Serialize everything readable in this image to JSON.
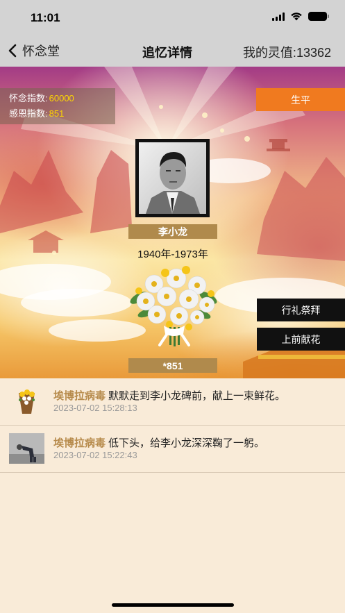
{
  "status_bar": {
    "time": "11:01",
    "icons": [
      "signal-icon",
      "wifi-icon",
      "battery-icon"
    ]
  },
  "nav": {
    "back_label": "怀念堂",
    "title": "追忆详情",
    "spirit_value": "我的灵值:13362"
  },
  "memorial": {
    "remembrance_label": "怀念指数:",
    "remembrance_value": "60000",
    "gratitude_label": "感恩指数:",
    "gratitude_value": "851",
    "biography_button": "生平",
    "name": "李小龙",
    "years": "1940年-1973年",
    "worship_button": "行礼祭拜",
    "offer_flower_button": "上前献花",
    "flower_count": "*851"
  },
  "feed": [
    {
      "user": "埃博拉病毒",
      "action": "默默走到李小龙碑前，献上一束鲜花。",
      "time": "2023-07-02 15:28:13",
      "avatar": "bouquet-avatar"
    },
    {
      "user": "埃博拉病毒",
      "action": "低下头，给李小龙深深鞠了一躬。",
      "time": "2023-07-02 15:22:43",
      "avatar": "bowing-avatar"
    }
  ],
  "colors": {
    "bar_bg": "#d3d3d3",
    "accent_orange": "#f07a1f",
    "plate_gold": "#b08a4c",
    "index_value": "#ffd800",
    "username": "#b78b4c",
    "feed_bg": "#f9ebd8"
  }
}
